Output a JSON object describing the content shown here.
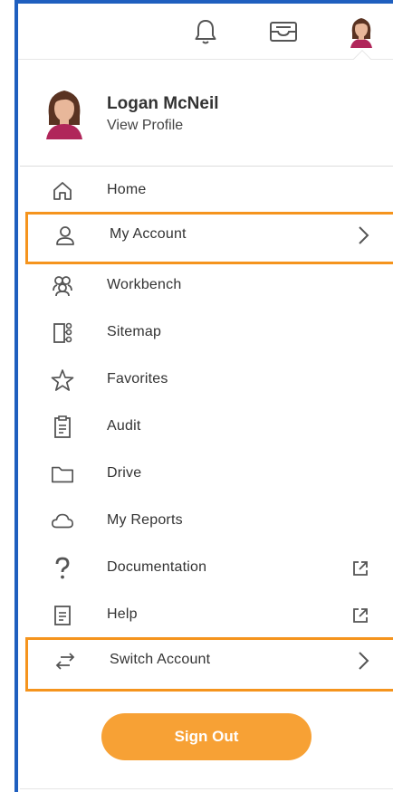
{
  "colors": {
    "frame_blue": "#1f5fbf",
    "highlight_orange": "#f5941d",
    "signout_orange": "#f7a135",
    "icon_gray": "#555555"
  },
  "topbar": {
    "icons": [
      "bell-icon",
      "inbox-icon",
      "avatar"
    ]
  },
  "profile": {
    "name": "Logan McNeil",
    "link": "View Profile"
  },
  "menu": [
    {
      "label": "Home",
      "icon": "home-icon"
    },
    {
      "label": "My Account",
      "icon": "person-icon",
      "right": "chevron-right-icon",
      "highlighted": true
    },
    {
      "label": "Workbench",
      "icon": "people-icon"
    },
    {
      "label": "Sitemap",
      "icon": "sitemap-icon"
    },
    {
      "label": "Favorites",
      "icon": "star-icon"
    },
    {
      "label": "Audit",
      "icon": "clipboard-icon"
    },
    {
      "label": "Drive",
      "icon": "folder-icon"
    },
    {
      "label": "My Reports",
      "icon": "cloud-icon"
    },
    {
      "label": "Documentation",
      "icon": "question-icon",
      "right": "external-link-icon"
    },
    {
      "label": "Help",
      "icon": "document-icon",
      "right": "external-link-icon"
    },
    {
      "label": "Switch Account",
      "icon": "switch-arrows-icon",
      "right": "chevron-right-icon",
      "highlighted": true
    }
  ],
  "sign_out_label": "Sign Out"
}
